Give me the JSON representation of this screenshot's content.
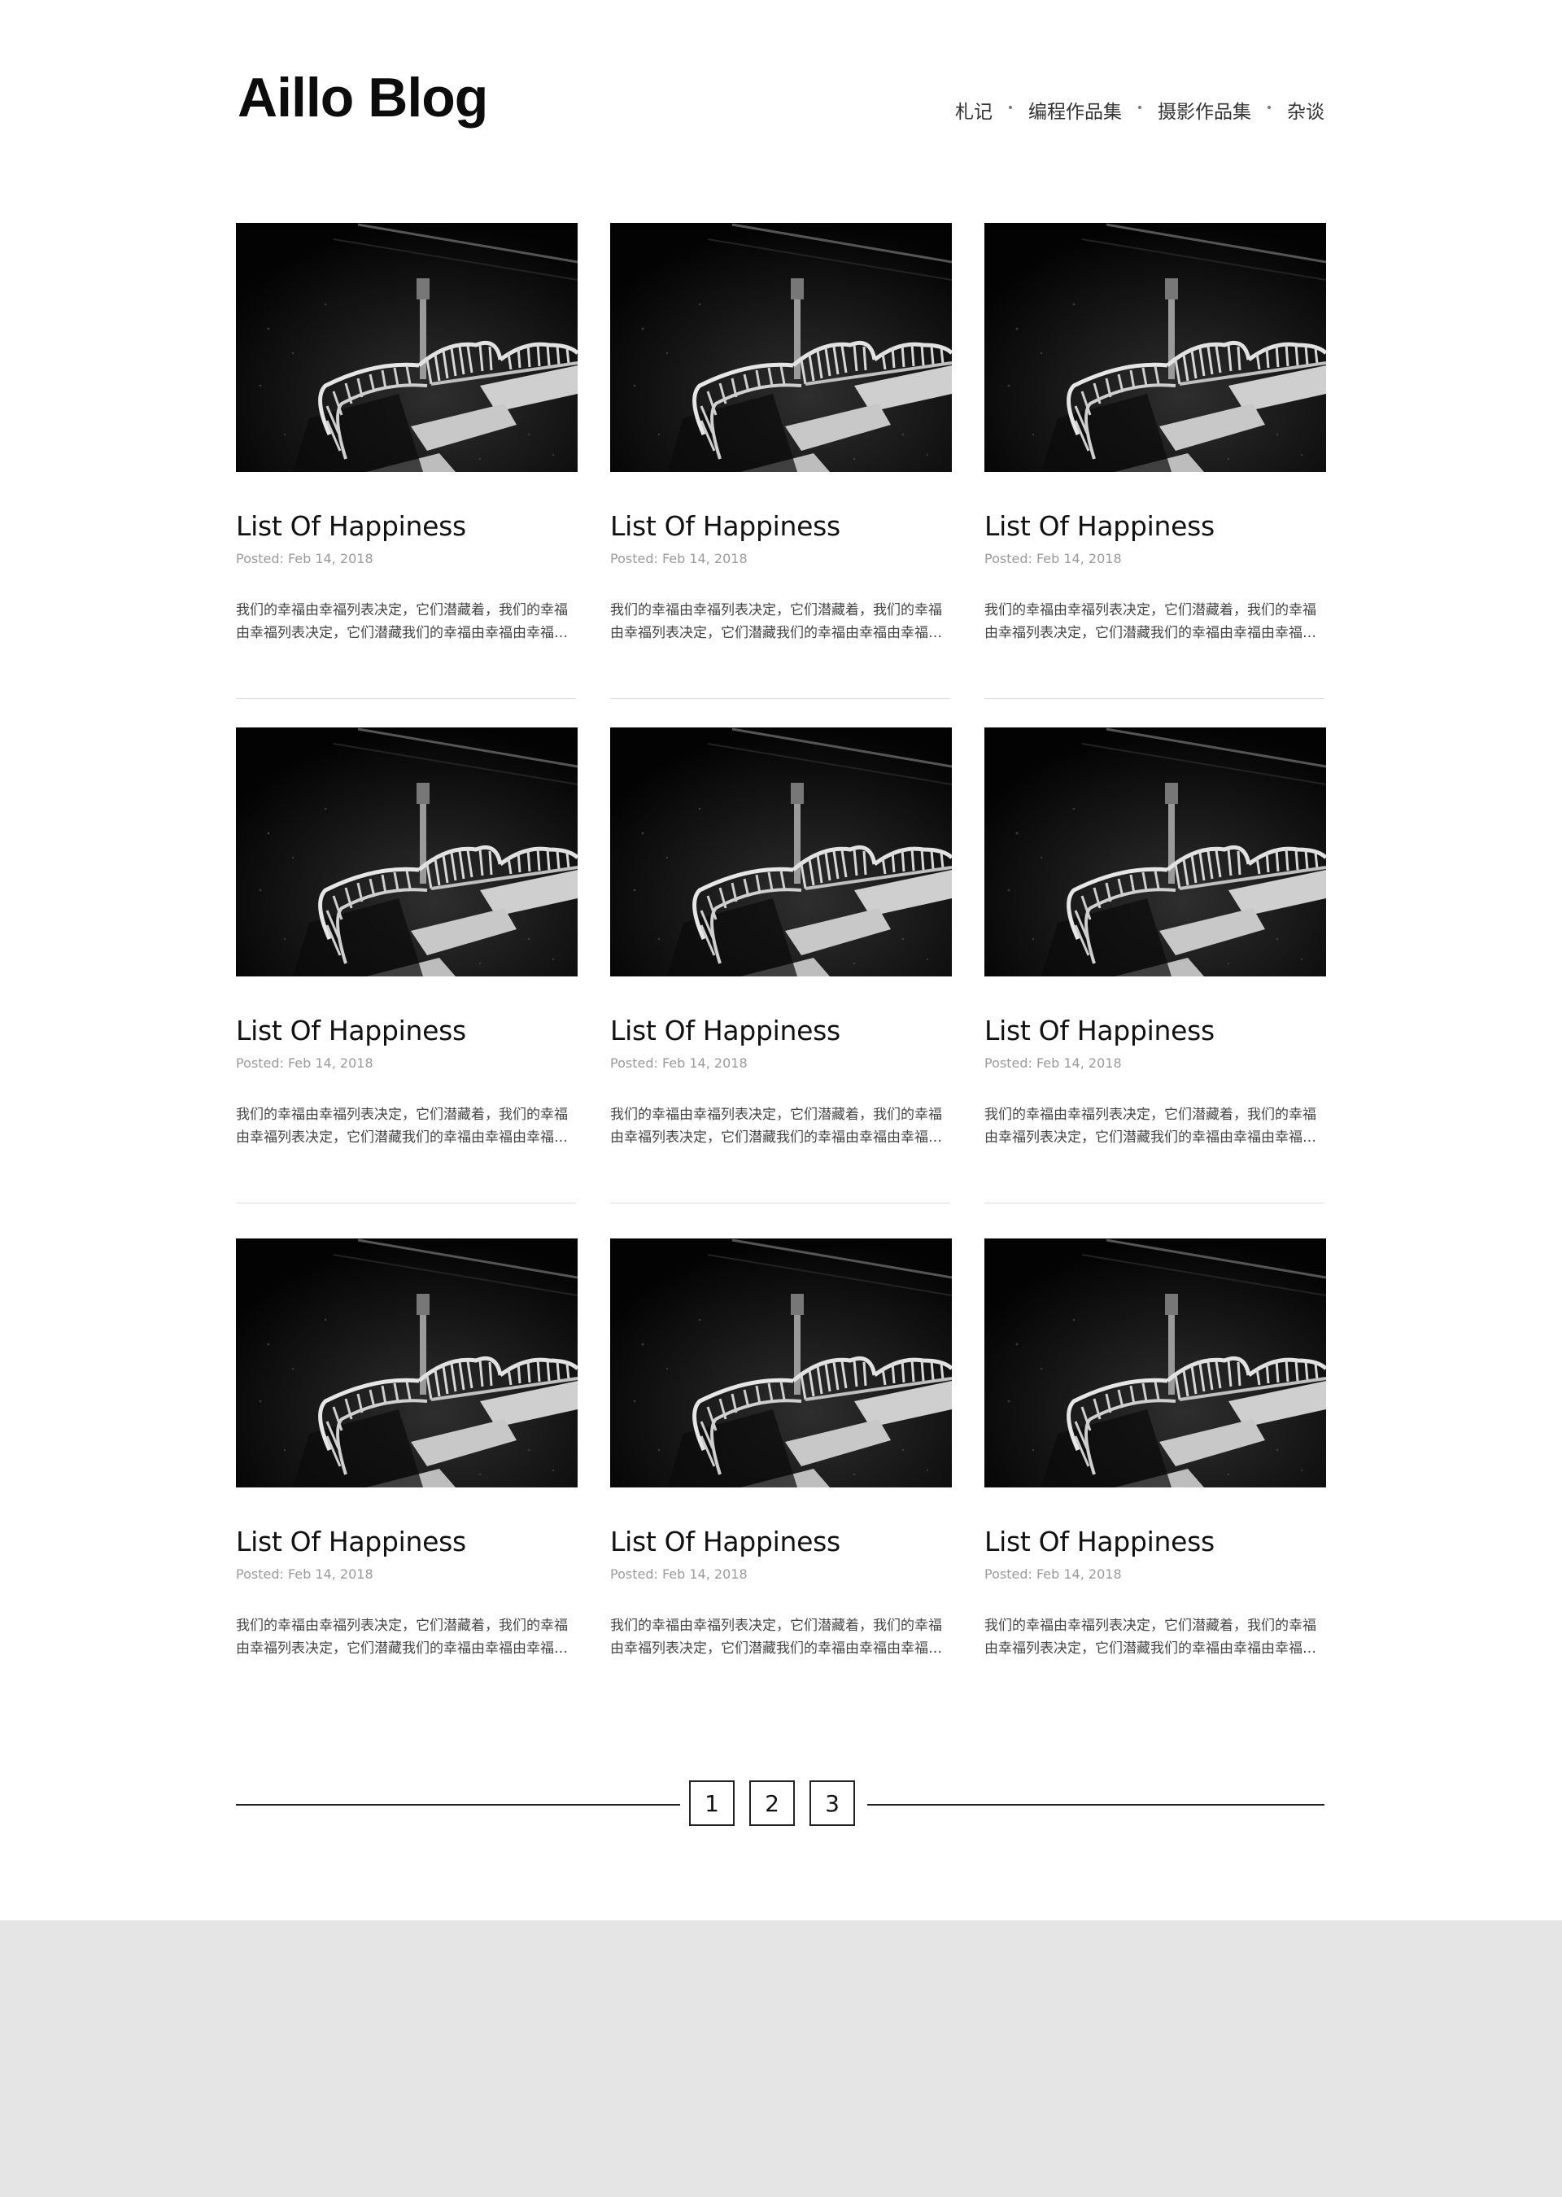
{
  "site": {
    "title": "Aillo Blog"
  },
  "nav": {
    "items": [
      {
        "label": "札记"
      },
      {
        "label": "编程作品集"
      },
      {
        "label": "摄影作品集"
      },
      {
        "label": "杂谈"
      }
    ]
  },
  "posts": [
    {
      "title": "List Of Happiness",
      "meta": "Posted:  Feb 14, 2018",
      "excerpt": "我们的幸福由幸福列表决定，它们潜藏着，我们的幸福由幸福列表决定，它们潜藏我们的幸福由幸福由幸福列表决定",
      "image": "black-and-white-railing-photo"
    },
    {
      "title": "List Of Happiness",
      "meta": "Posted:  Feb 14, 2018",
      "excerpt": "我们的幸福由幸福列表决定，它们潜藏着，我们的幸福由幸福列表决定，它们潜藏我们的幸福由幸福由幸福列表决定",
      "image": "black-and-white-railing-photo"
    },
    {
      "title": "List Of Happiness",
      "meta": "Posted:  Feb 14, 2018",
      "excerpt": "我们的幸福由幸福列表决定，它们潜藏着，我们的幸福由幸福列表决定，它们潜藏我们的幸福由幸福由幸福列表决定",
      "image": "black-and-white-railing-photo"
    },
    {
      "title": "List Of Happiness",
      "meta": "Posted:  Feb 14, 2018",
      "excerpt": "我们的幸福由幸福列表决定，它们潜藏着，我们的幸福由幸福列表决定，它们潜藏我们的幸福由幸福由幸福列表决定",
      "image": "black-and-white-railing-photo"
    },
    {
      "title": "List Of Happiness",
      "meta": "Posted:  Feb 14, 2018",
      "excerpt": "我们的幸福由幸福列表决定，它们潜藏着，我们的幸福由幸福列表决定，它们潜藏我们的幸福由幸福由幸福列表决定",
      "image": "black-and-white-railing-photo"
    },
    {
      "title": "List Of Happiness",
      "meta": "Posted:  Feb 14, 2018",
      "excerpt": "我们的幸福由幸福列表决定，它们潜藏着，我们的幸福由幸福列表决定，它们潜藏我们的幸福由幸福由幸福列表决定",
      "image": "black-and-white-railing-photo"
    },
    {
      "title": "List Of Happiness",
      "meta": "Posted:  Feb 14, 2018",
      "excerpt": "我们的幸福由幸福列表决定，它们潜藏着，我们的幸福由幸福列表决定，它们潜藏我们的幸福由幸福由幸福列表决定",
      "image": "black-and-white-railing-photo"
    },
    {
      "title": "List Of Happiness",
      "meta": "Posted:  Feb 14, 2018",
      "excerpt": "我们的幸福由幸福列表决定，它们潜藏着，我们的幸福由幸福列表决定，它们潜藏我们的幸福由幸福由幸福列表决定",
      "image": "black-and-white-railing-photo"
    },
    {
      "title": "List Of Happiness",
      "meta": "Posted:  Feb 14, 2018",
      "excerpt": "我们的幸福由幸福列表决定，它们潜藏着，我们的幸福由幸福列表决定，它们潜藏我们的幸福由幸福由幸福列表决定",
      "image": "black-and-white-railing-photo"
    }
  ],
  "pagination": {
    "pages": [
      "1",
      "2",
      "3"
    ]
  },
  "colors": {
    "background": "#ffffff",
    "footer": "#e5e5e5",
    "text": "#111111",
    "meta": "#9a9a9a"
  }
}
